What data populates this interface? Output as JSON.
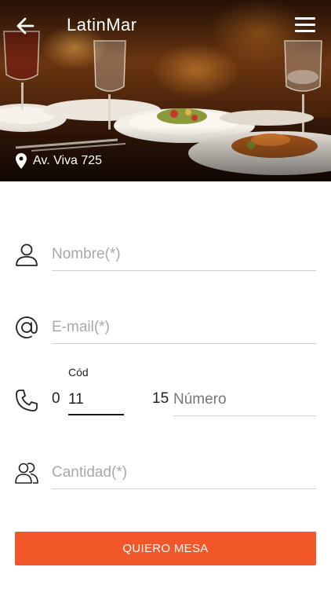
{
  "header": {
    "title": "LatinMar",
    "back_icon": "arrow-left-icon",
    "menu_icon": "hamburger-menu-icon",
    "address": "Av. Viva 725",
    "address_icon": "map-pin-icon"
  },
  "form": {
    "name": {
      "placeholder": "Nombre(*)",
      "value": "",
      "icon": "user-icon"
    },
    "email": {
      "placeholder": "E-mail(*)",
      "value": "",
      "icon": "at-sign-icon"
    },
    "phone": {
      "icon": "phone-icon",
      "code_label": "Cód",
      "code_prefix": "0",
      "code_value": "11",
      "number_prefix": "15",
      "number_placeholder": "Número",
      "number_value": ""
    },
    "quantity": {
      "placeholder": "Cantidad(*)",
      "value": "",
      "icon": "users-icon"
    }
  },
  "submit": {
    "label": "QUIERO MESA",
    "color": "#f2572a"
  }
}
